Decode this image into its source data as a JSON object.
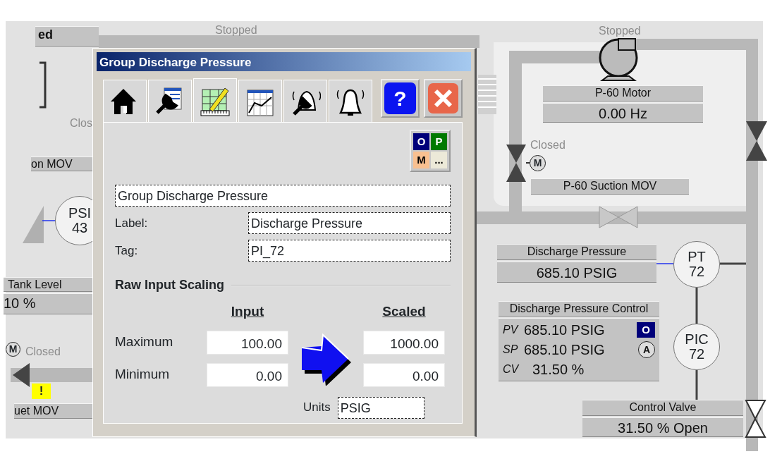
{
  "canvas": {
    "left_header": "ed",
    "left_status": "Clos",
    "left_mov": "on MOV",
    "left_instrument": {
      "line1": "PSI",
      "line2": "43"
    },
    "tank_level": {
      "title": "Tank Level",
      "value": "10 %"
    },
    "left_valve": {
      "status": "Closed",
      "motor": "M",
      "alarm": "!"
    },
    "left_outlet": "uet MOV",
    "center_pump_status": "Stopped",
    "p60_motor": {
      "status": "Stopped",
      "title": "P-60 Motor",
      "value": "0.00 Hz"
    },
    "suction_valve": {
      "status": "Closed",
      "motor": "M",
      "title": "P-60 Suction MOV"
    },
    "discharge_pressure": {
      "title": "Discharge Pressure",
      "value": "685.10 PSIG"
    },
    "pt": {
      "line1": "PT",
      "line2": "72"
    },
    "controller": {
      "title": "Discharge Pressure Control",
      "rows": [
        {
          "label": "PV",
          "value": "685.10 PSIG",
          "badge": {
            "kind": "box",
            "text": "O"
          }
        },
        {
          "label": "SP",
          "value": "685.10 PSIG",
          "badge": {
            "kind": "circle",
            "text": "A"
          }
        },
        {
          "label": "CV",
          "value": "31.50 %"
        }
      ]
    },
    "pic": {
      "line1": "PIC",
      "line2": "72"
    },
    "control_valve": {
      "title": "Control Valve",
      "value": "31.50 % Open"
    }
  },
  "dialog": {
    "title": "Group Discharge Pressure",
    "tabs": [
      {
        "kind": "home",
        "selected": false
      },
      {
        "kind": "tools",
        "selected": false
      },
      {
        "kind": "edit",
        "selected": true
      },
      {
        "kind": "trend",
        "selected": false
      },
      {
        "kind": "alarm-tools",
        "selected": false
      },
      {
        "kind": "alarm",
        "selected": false
      }
    ],
    "help_button": "?",
    "mode_button": [
      "O",
      "P",
      "M",
      "..."
    ],
    "group_name": "Group Discharge Pressure",
    "label_field": {
      "label": "Label:",
      "value": "Discharge Pressure"
    },
    "tag_field": {
      "label": "Tag:",
      "value": "PI_72"
    },
    "scaling": {
      "title": "Raw Input Scaling",
      "columns": [
        "Input",
        "Scaled"
      ],
      "rows": [
        {
          "label": "Maximum",
          "input": "100.00",
          "scaled": "1000.00"
        },
        {
          "label": "Minimum",
          "input": "0.00",
          "scaled": "0.00"
        }
      ],
      "units": {
        "label": "Units",
        "value": "PSIG"
      }
    }
  }
}
